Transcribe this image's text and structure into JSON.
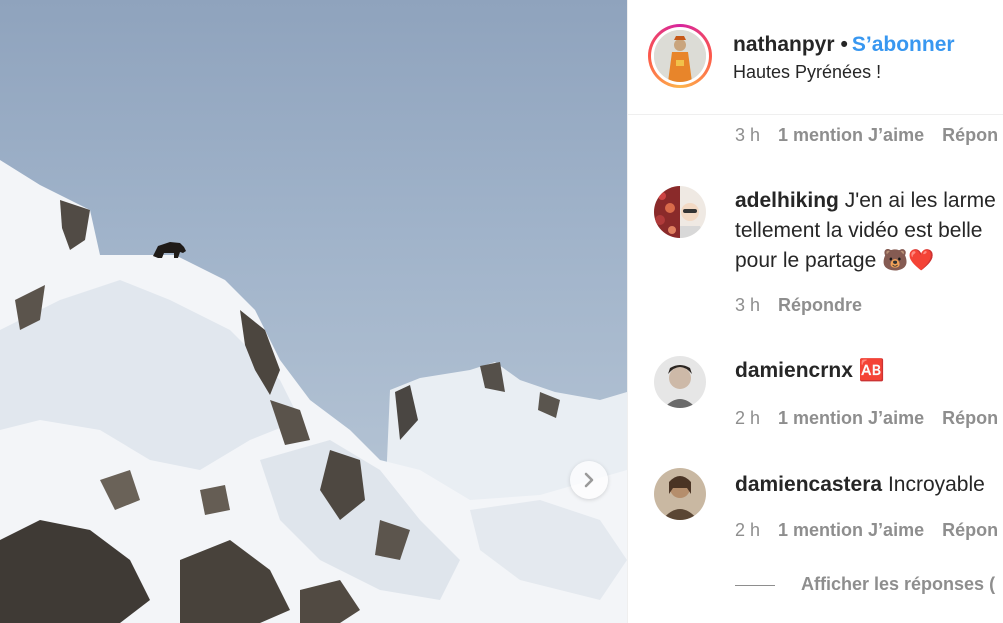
{
  "post": {
    "username": "nathanpyr",
    "separator": "•",
    "follow_label": "S’abonner",
    "caption": "Hautes Pyrénées !"
  },
  "first_meta": {
    "time": "3 h",
    "likes": "1 mention J’aime",
    "reply": "Répon"
  },
  "comments": [
    {
      "username": "adelhiking",
      "lines": [
        "J'en ai les larme",
        "tellement la vidéo est belle",
        "pour le partage 🐻❤️"
      ],
      "time": "3 h",
      "reply": "Répondre"
    },
    {
      "username": "damiencrnx",
      "text": "🆎",
      "time": "2 h",
      "likes": "1 mention J’aime",
      "reply": "Répon"
    },
    {
      "username": "damiencastera",
      "text": "Incroyable",
      "time": "2 h",
      "likes": "1 mention J’aime",
      "reply": "Répon"
    }
  ],
  "view_replies": "Afficher les réponses (",
  "colors": {
    "link_blue": "#3897f0",
    "muted": "#8e8e8e",
    "text": "#262626"
  },
  "icons": [
    "chevron-right-icon"
  ]
}
